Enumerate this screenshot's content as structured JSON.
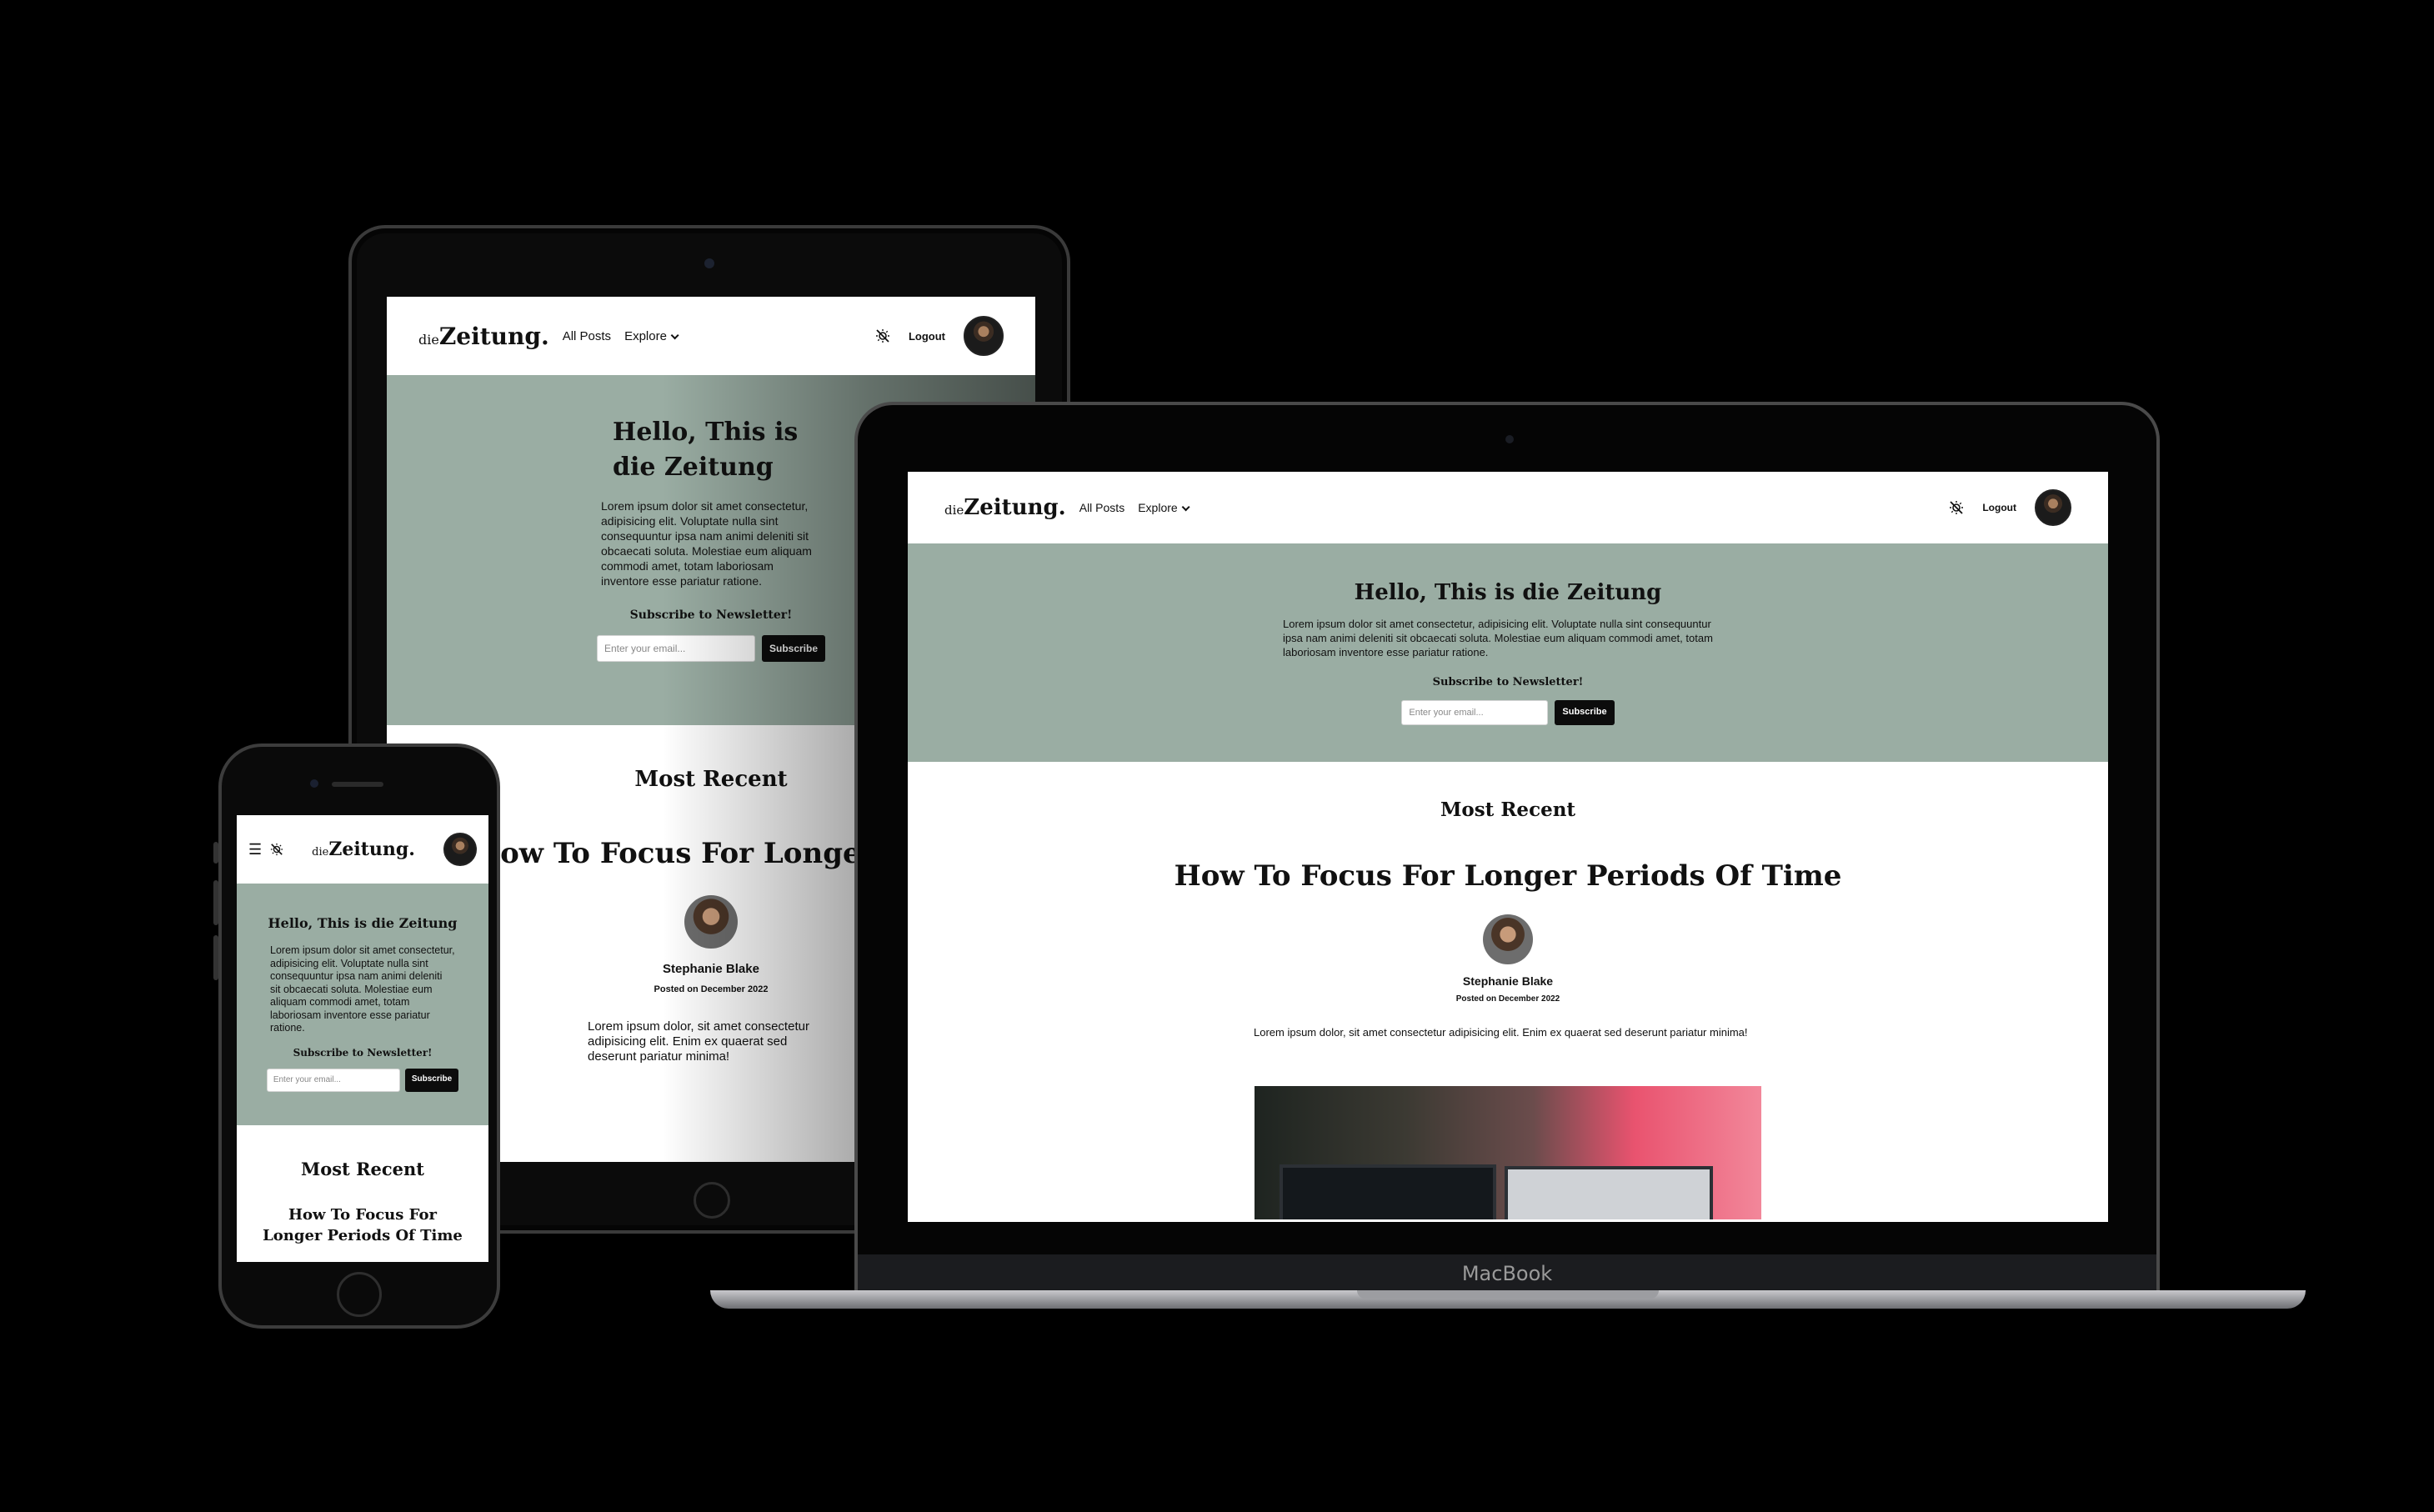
{
  "site": {
    "logo_prefix": "die",
    "logo_main": "Zeitung.",
    "nav": {
      "all_posts": "All Posts",
      "explore": "Explore",
      "logout": "Logout"
    },
    "hero": {
      "title": "Hello, This is die Zeitung",
      "text": "Lorem ipsum dolor sit amet consectetur, adipisicing elit. Voluptate nulla sint consequuntur ipsa nam animi deleniti sit obcaecati soluta. Molestiae eum aliquam commodi amet, totam laboriosam inventore esse pariatur ratione.",
      "subscribe_label": "Subscribe to Newsletter!",
      "email_placeholder": "Enter your email...",
      "subscribe_button": "Subscribe"
    },
    "most_recent": "Most Recent",
    "post": {
      "title": "How To Focus For Longer Periods Of Time",
      "author": "Stephanie Blake",
      "posted": "Posted on December 2022",
      "excerpt": "Lorem ipsum dolor, sit amet consectetur adipisicing elit. Enim ex quaerat sed deserunt pariatur minima!"
    }
  },
  "device": {
    "laptop_label": "MacBook"
  },
  "colors": {
    "hero_bg": "#9aada3",
    "page_bg": "#000000",
    "button_bg": "#0c0c0c"
  },
  "icons": {
    "theme_toggle": "sun-slash-icon",
    "menu": "hamburger-icon",
    "dropdown": "chevron-down-icon"
  }
}
